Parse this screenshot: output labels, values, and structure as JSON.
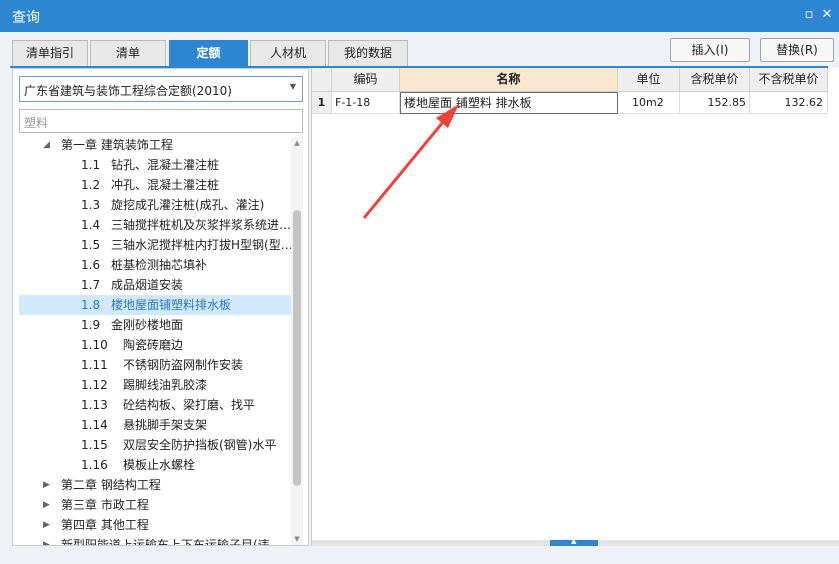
{
  "window": {
    "title": "查询",
    "restore_glyph": "▫",
    "close_glyph": "✕"
  },
  "tabs": [
    "清单指引",
    "清单",
    "定额",
    "人材机",
    "我的数据"
  ],
  "active_tab": 2,
  "actions": {
    "insert": "插入(I)",
    "replace": "替换(R)"
  },
  "library": {
    "selected": "广东省建筑与装饰工程综合定额(2010)"
  },
  "search": {
    "value": "塑料"
  },
  "tree": [
    {
      "level": 0,
      "expanded": true,
      "code": "",
      "label": "第一章  建筑装饰工程"
    },
    {
      "level": 1,
      "code": "1.1",
      "label": "钻孔、混凝土灌注桩"
    },
    {
      "level": 1,
      "code": "1.2",
      "label": "冲孔、混凝土灌注桩"
    },
    {
      "level": 1,
      "code": "1.3",
      "label": "旋挖成孔灌注桩(成孔、灌注)"
    },
    {
      "level": 1,
      "code": "1.4",
      "label": "三轴搅拌桩机及灰浆拌浆系统进…"
    },
    {
      "level": 1,
      "code": "1.5",
      "label": "三轴水泥搅拌桩内打拔H型钢(型…"
    },
    {
      "level": 1,
      "code": "1.6",
      "label": "桩基检测抽芯填补"
    },
    {
      "level": 1,
      "code": "1.7",
      "label": "成品烟道安装"
    },
    {
      "level": 1,
      "code": "1.8",
      "label": "楼地屋面铺塑料排水板",
      "selected": true
    },
    {
      "level": 1,
      "code": "1.9",
      "label": "金刚砂楼地面"
    },
    {
      "level": 1,
      "code": "1.10",
      "label": "陶瓷砖磨边"
    },
    {
      "level": 1,
      "code": "1.11",
      "label": "不锈钢防盗网制作安装"
    },
    {
      "level": 1,
      "code": "1.12",
      "label": "踢脚线油乳胶漆"
    },
    {
      "level": 1,
      "code": "1.13",
      "label": "砼结构板、梁打磨、找平"
    },
    {
      "level": 1,
      "code": "1.14",
      "label": "悬挑脚手架支架"
    },
    {
      "level": 1,
      "code": "1.15",
      "label": "双层安全防护挡板(钢管)水平"
    },
    {
      "level": 1,
      "code": "1.16",
      "label": "模板止水螺栓"
    },
    {
      "level": 0,
      "expanded": false,
      "code": "",
      "label": "第二章  钢结构工程"
    },
    {
      "level": 0,
      "expanded": false,
      "code": "",
      "label": "第三章  市政工程"
    },
    {
      "level": 0,
      "expanded": false,
      "code": "",
      "label": "第四章  其他工程"
    },
    {
      "level": 0,
      "expanded": false,
      "code": "",
      "label": "新型阳能道上运输车上下车运输子目(违"
    }
  ],
  "grid": {
    "columns": [
      "编码",
      "名称",
      "单位",
      "含税单价",
      "不含税单价"
    ],
    "rows": [
      {
        "num": "1",
        "code": "F-1-18",
        "name": "楼地屋面 铺塑料 排水板",
        "unit": "10m2",
        "price_tax": "152.85",
        "price_notax": "132.62"
      }
    ]
  },
  "colors": {
    "accent": "#2e86d3",
    "annotation_arrow": "#f0423c"
  }
}
